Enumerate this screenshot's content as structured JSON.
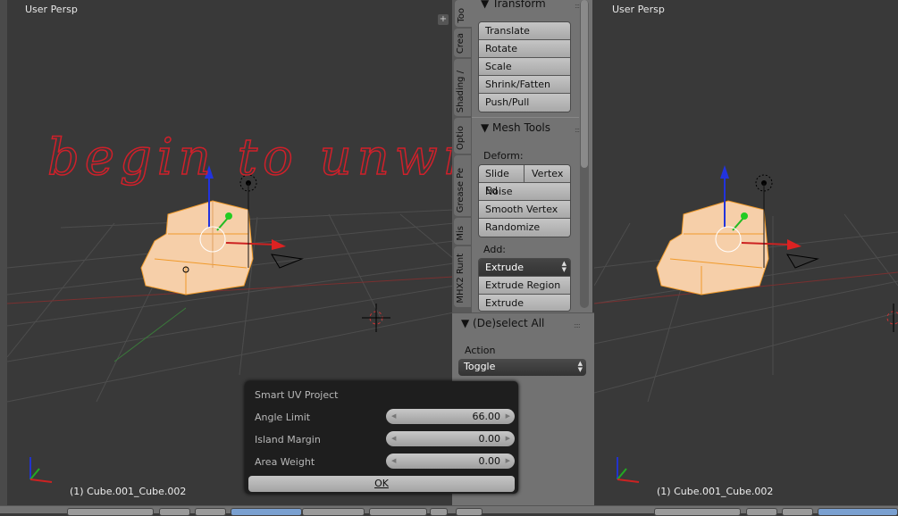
{
  "viewport_left": {
    "view_label": "User Persp",
    "object_label": "(1) Cube.001_Cube.002",
    "annotation": "begin to unwrap"
  },
  "viewport_right": {
    "view_label": "User Persp",
    "object_label": "(1) Cube.001_Cube.002"
  },
  "tabs": [
    "Too",
    "Crea",
    "Shading /",
    "Optio",
    "Grease Pe",
    "Mis",
    "MHX2 Runt"
  ],
  "transform": {
    "title": "Transform",
    "buttons": [
      "Translate",
      "Rotate",
      "Scale",
      "Shrink/Fatten",
      "Push/Pull"
    ]
  },
  "mesh_tools": {
    "title": "Mesh Tools",
    "deform_label": "Deform:",
    "slide_edge": "Slide Ed",
    "vertex": "Vertex",
    "buttons": [
      "Noise",
      "Smooth Vertex",
      "Randomize"
    ],
    "add_label": "Add:",
    "extrude_select": "Extrude",
    "add_buttons": [
      "Extrude Region",
      "Extrude Individual"
    ]
  },
  "operator": {
    "title": "(De)select All",
    "action_label": "Action",
    "action_value": "Toggle"
  },
  "dialog": {
    "title": "Smart UV Project",
    "fields": [
      {
        "label": "Angle Limit",
        "value": "66.00"
      },
      {
        "label": "Island Margin",
        "value": "0.00"
      },
      {
        "label": "Area Weight",
        "value": "0.00"
      }
    ],
    "ok": "OK"
  },
  "colors": {
    "annotation": "#d0202a",
    "mesh": "#f7cfa8",
    "edge": "#f09a2a"
  }
}
